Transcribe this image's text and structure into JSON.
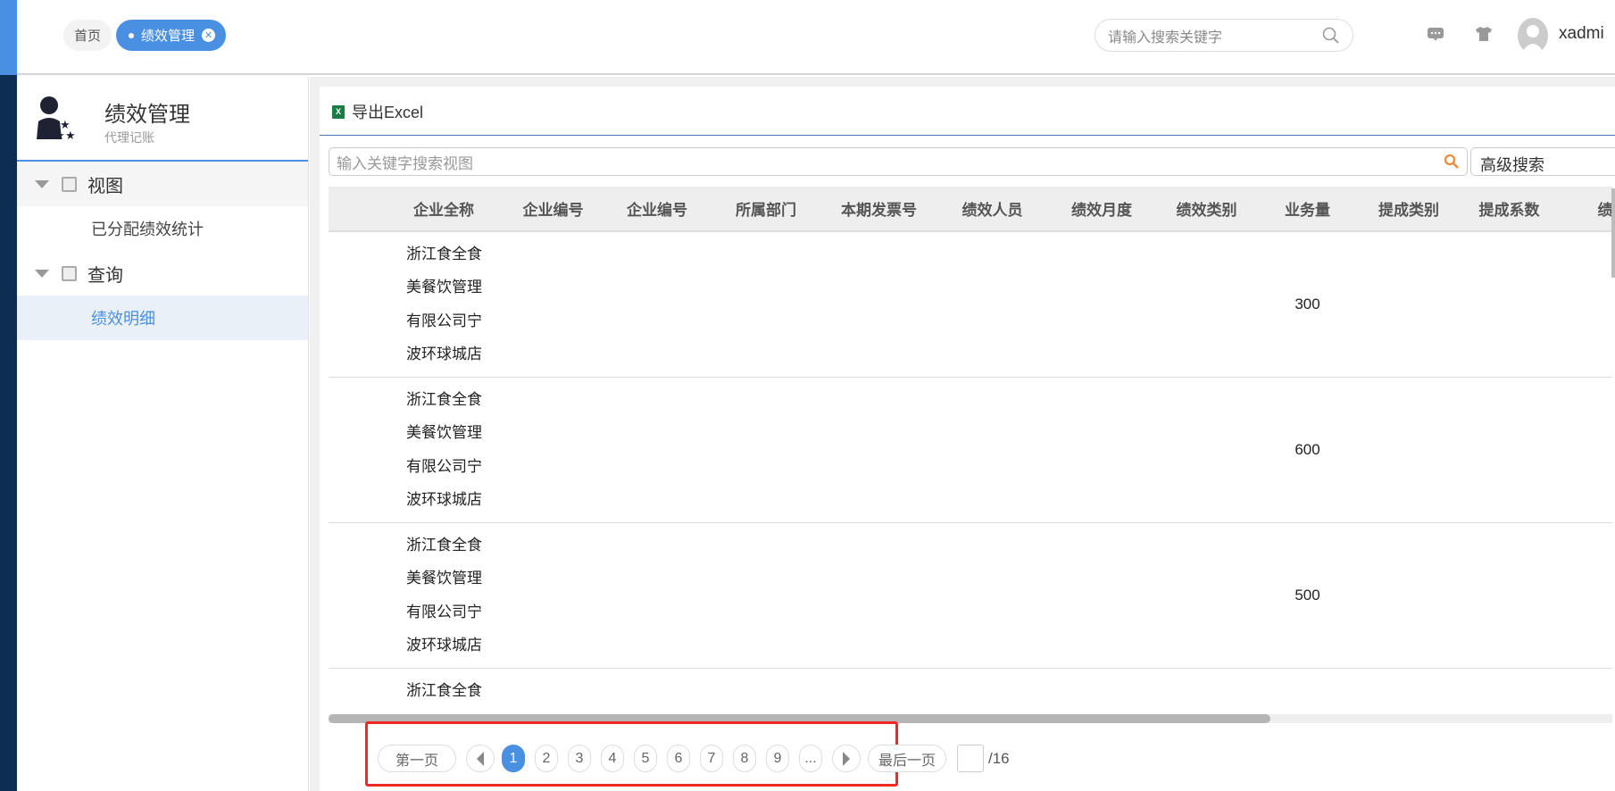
{
  "tabs": [
    {
      "label": "首页"
    },
    {
      "label": "绩效管理",
      "active": true
    }
  ],
  "header": {
    "search_placeholder": "请输入搜索关键字",
    "username": "xadmi"
  },
  "sidebar": {
    "title": "绩效管理",
    "subtitle": "代理记账",
    "groups": [
      {
        "label": "视图",
        "items": [
          {
            "label": "已分配绩效统计"
          }
        ]
      },
      {
        "label": "查询",
        "items": [
          {
            "label": "绩效明细",
            "active": true
          }
        ]
      }
    ]
  },
  "toolbar": {
    "export_label": "导出Excel"
  },
  "view_search": {
    "placeholder": "输入关键字搜索视图",
    "advanced_label": "高级搜索"
  },
  "table": {
    "columns": [
      "企业全称",
      "企业编号",
      "企业编号",
      "所属部门",
      "本期发票号",
      "绩效人员",
      "绩效月度",
      "绩效类别",
      "业务量",
      "提成类别",
      "提成系数",
      "绩效"
    ],
    "rows": [
      {
        "company": "浙江食全食美餐饮管理有限公司宁波环球城店",
        "volume": "300"
      },
      {
        "company": "浙江食全食美餐饮管理有限公司宁波环球城店",
        "volume": "600"
      },
      {
        "company": "浙江食全食美餐饮管理有限公司宁波环球城店",
        "volume": "500"
      },
      {
        "company": "浙江食全食美餐饮管理有限公司宁波环球城店",
        "volume": ""
      }
    ]
  },
  "pagination": {
    "first_label": "第一页",
    "last_label": "最后一页",
    "pages": [
      "1",
      "2",
      "3",
      "4",
      "5",
      "6",
      "7",
      "8",
      "9",
      "..."
    ],
    "current": 1,
    "total": "/16"
  },
  "colors": {
    "accent": "#4a90e2",
    "sidebar_dark": "#0d2d52",
    "highlight": "#ee2a22"
  }
}
